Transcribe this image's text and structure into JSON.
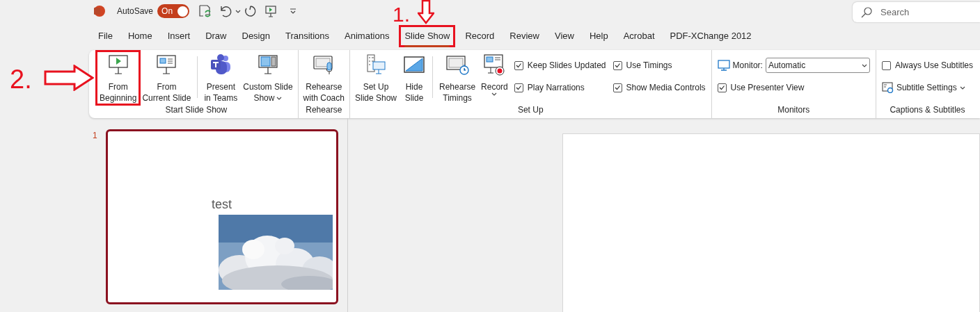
{
  "titlebar": {
    "autosave_label": "AutoSave",
    "autosave_toggle": {
      "label": "On",
      "on": true
    },
    "search": {
      "placeholder": "Search"
    }
  },
  "tabs": [
    {
      "label": "File",
      "selected": false,
      "highlighted": false
    },
    {
      "label": "Home",
      "selected": false,
      "highlighted": false
    },
    {
      "label": "Insert",
      "selected": false,
      "highlighted": false
    },
    {
      "label": "Draw",
      "selected": false,
      "highlighted": false
    },
    {
      "label": "Design",
      "selected": false,
      "highlighted": false
    },
    {
      "label": "Transitions",
      "selected": false,
      "highlighted": false
    },
    {
      "label": "Animations",
      "selected": false,
      "highlighted": false
    },
    {
      "label": "Slide Show",
      "selected": true,
      "highlighted": true
    },
    {
      "label": "Record",
      "selected": false,
      "highlighted": false
    },
    {
      "label": "Review",
      "selected": false,
      "highlighted": false
    },
    {
      "label": "View",
      "selected": false,
      "highlighted": false
    },
    {
      "label": "Help",
      "selected": false,
      "highlighted": false
    },
    {
      "label": "Acrobat",
      "selected": false,
      "highlighted": false
    },
    {
      "label": "PDF-XChange 2012",
      "selected": false,
      "highlighted": false
    }
  ],
  "ribbon": {
    "groups": [
      {
        "label": "Start Slide Show",
        "items": [
          {
            "kind": "large",
            "lines": [
              "From",
              "Beginning"
            ],
            "highlighted": true
          },
          {
            "kind": "large",
            "lines": [
              "From",
              "Current Slide"
            ]
          },
          {
            "kind": "large",
            "lines": [
              "Present",
              "in Teams"
            ],
            "separator_before": true
          },
          {
            "kind": "large",
            "lines": [
              "Custom Slide",
              "Show"
            ],
            "dropdown": true
          }
        ]
      },
      {
        "label": "Rehearse",
        "items": [
          {
            "kind": "large",
            "lines": [
              "Rehearse",
              "with Coach"
            ]
          }
        ]
      },
      {
        "label": "Set Up",
        "items": [
          {
            "kind": "large",
            "lines": [
              "Set Up",
              "Slide Show"
            ]
          },
          {
            "kind": "large",
            "lines": [
              "Hide",
              "Slide"
            ]
          },
          {
            "kind": "large",
            "lines": [
              "Rehearse",
              "Timings"
            ],
            "separator_before": true
          },
          {
            "kind": "large",
            "lines": [
              "Record"
            ],
            "dropdown": true
          },
          {
            "kind": "stack",
            "rows": [
              {
                "kind": "check",
                "label": "Keep Slides Updated",
                "checked": true
              },
              {
                "kind": "check",
                "label": "Play Narrations",
                "checked": true
              }
            ]
          },
          {
            "kind": "stack",
            "rows": [
              {
                "kind": "check",
                "label": "Use Timings",
                "checked": true
              },
              {
                "kind": "check",
                "label": "Show Media Controls",
                "checked": true
              }
            ]
          }
        ]
      },
      {
        "label": "Monitors",
        "items": [
          {
            "kind": "stack",
            "rows": [
              {
                "kind": "select",
                "label": "Monitor:",
                "value": "Automatic"
              },
              {
                "kind": "check",
                "label": "Use Presenter View",
                "checked": true
              }
            ]
          }
        ]
      },
      {
        "label": "Captions & Subtitles",
        "items": [
          {
            "kind": "stack",
            "rows": [
              {
                "kind": "check",
                "label": "Always Use Subtitles",
                "checked": false
              },
              {
                "kind": "menu",
                "label": "Subtitle Settings"
              }
            ]
          }
        ]
      }
    ]
  },
  "slides": [
    {
      "number": "1",
      "selected": true,
      "title": "test"
    }
  ],
  "annotations": [
    {
      "kind": "down",
      "text": "1."
    },
    {
      "kind": "right",
      "text": "2."
    }
  ]
}
